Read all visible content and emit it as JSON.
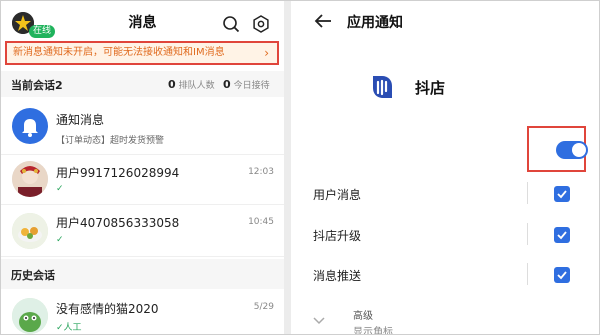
{
  "left": {
    "online_badge": "在线",
    "title": "消息",
    "banner": {
      "text": "新消息通知未开启，可能无法接收通知和IM消息",
      "arrow": "›"
    },
    "current_section": {
      "title": "当前会话2",
      "queue_count": "0",
      "queue_label": "排队人数",
      "today_count": "0",
      "today_label": "今日接待"
    },
    "conversations": [
      {
        "name": "通知消息",
        "sub": "【订单动态】超时发货预警",
        "time": "",
        "icon": "bell-icon"
      },
      {
        "name": "用户9917126028994",
        "sub": "✓",
        "time": "12:03",
        "icon": "user-avatar"
      },
      {
        "name": "用户4070856333058",
        "sub": "✓",
        "time": "10:45",
        "icon": "user-avatar"
      }
    ],
    "history_section": {
      "title": "历史会话"
    },
    "history": [
      {
        "name": "没有感情的猫2020",
        "sub": "✓人工",
        "time": "5/29"
      }
    ]
  },
  "right": {
    "title": "应用通知",
    "app_name": "抖店",
    "toggle_on": true,
    "permissions": [
      {
        "label": "用户消息",
        "checked": true
      },
      {
        "label": "抖店升级",
        "checked": true
      },
      {
        "label": "消息推送",
        "checked": true
      }
    ],
    "advanced": {
      "title": "高级",
      "subtitle": "显示角标"
    }
  },
  "colors": {
    "accent": "#2f6ee0",
    "alert_border": "#e0453b",
    "banner_text": "#e06b1f",
    "online": "#1fb35c"
  }
}
